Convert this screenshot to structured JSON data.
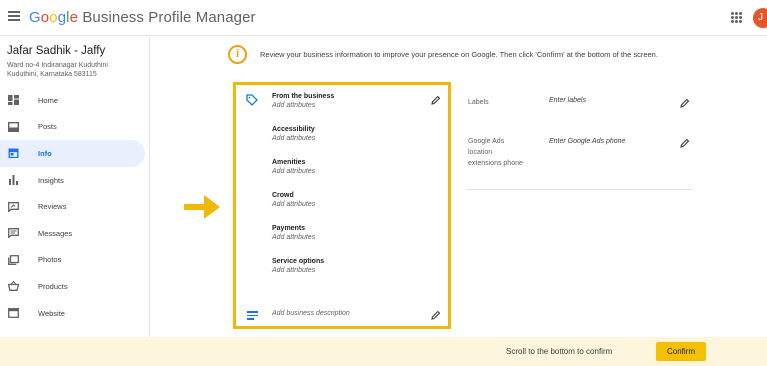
{
  "header": {
    "brand_google_letters": [
      "G",
      "o",
      "o",
      "g",
      "l",
      "e"
    ],
    "brand_rest": "Business Profile Manager",
    "avatar_initial": "J"
  },
  "business": {
    "name": "Jafar Sadhik - Jaffy",
    "address_line1": "Ward no-4 Indiranagar Kuduthini",
    "address_line2": "Kuduthini, Karnataka 583115"
  },
  "nav": {
    "items": [
      {
        "label": "Home",
        "icon": "home-grid-icon"
      },
      {
        "label": "Posts",
        "icon": "posts-icon"
      },
      {
        "label": "Info",
        "icon": "storefront-icon",
        "active": true
      },
      {
        "label": "Insights",
        "icon": "bar-chart-icon"
      },
      {
        "label": "Reviews",
        "icon": "reviews-icon"
      },
      {
        "label": "Messages",
        "icon": "message-icon"
      },
      {
        "label": "Photos",
        "icon": "photos-icon"
      },
      {
        "label": "Products",
        "icon": "basket-icon"
      },
      {
        "label": "Website",
        "icon": "website-icon"
      }
    ]
  },
  "notice": {
    "text": "Review your business information to improve your presence on Google. Then click 'Confirm' at the bottom of the screen."
  },
  "attributes_card": {
    "groups": [
      {
        "title": "From the business",
        "subtitle": "Add attributes"
      },
      {
        "title": "Accessibility",
        "subtitle": "Add attributes"
      },
      {
        "title": "Amenities",
        "subtitle": "Add attributes"
      },
      {
        "title": "Crowd",
        "subtitle": "Add attributes"
      },
      {
        "title": "Payments",
        "subtitle": "Add attributes"
      },
      {
        "title": "Service options",
        "subtitle": "Add attributes"
      }
    ],
    "description_placeholder": "Add business description"
  },
  "right_fields": {
    "labels": {
      "label": "Labels",
      "value": "Enter labels"
    },
    "ads_phone": {
      "label_lines": [
        "Google Ads",
        "location",
        "extensions phone"
      ],
      "value": "Enter Google Ads phone"
    }
  },
  "footer": {
    "scroll_text": "Scroll to the bottom to confirm",
    "confirm_label": "Confirm"
  },
  "colors": {
    "highlight": "#f0b90a",
    "accent": "#1a73e8",
    "confirm_button": "#f5c000",
    "footer_bg": "#fdf6dd"
  }
}
